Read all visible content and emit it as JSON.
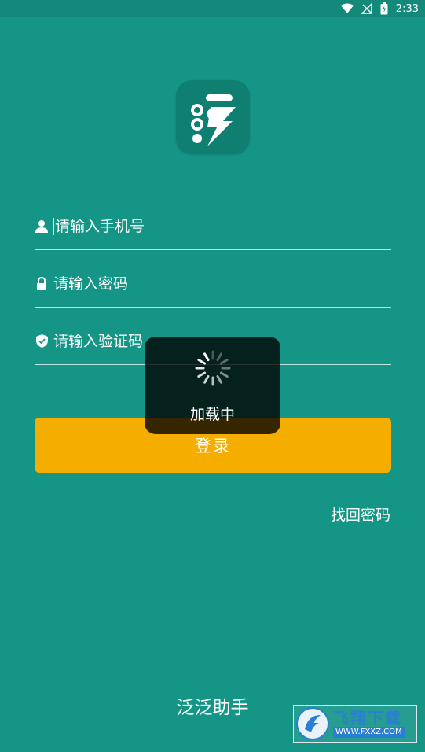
{
  "status_bar": {
    "time": "2:33",
    "icons": [
      "wifi-icon",
      "no-signal-icon",
      "battery-charging-icon"
    ]
  },
  "app": {
    "name": "泛泛助手",
    "logo_icon": "app-logo-icon"
  },
  "form": {
    "phone_placeholder": "请输入手机号",
    "password_placeholder": "请输入密码",
    "code_placeholder": "请输入验证码",
    "phone_icon": "user-icon",
    "password_icon": "lock-icon",
    "code_icon": "shield-check-icon"
  },
  "actions": {
    "login_label": "登录",
    "forgot_label": "找回密码"
  },
  "loading": {
    "text": "加载中"
  },
  "watermark": {
    "title": "飞翔下载",
    "url": "WWW.FXXZ.COM"
  },
  "colors": {
    "background": "#149585",
    "accent": "#f5ad00",
    "logo_bg": "#0f7f71"
  }
}
